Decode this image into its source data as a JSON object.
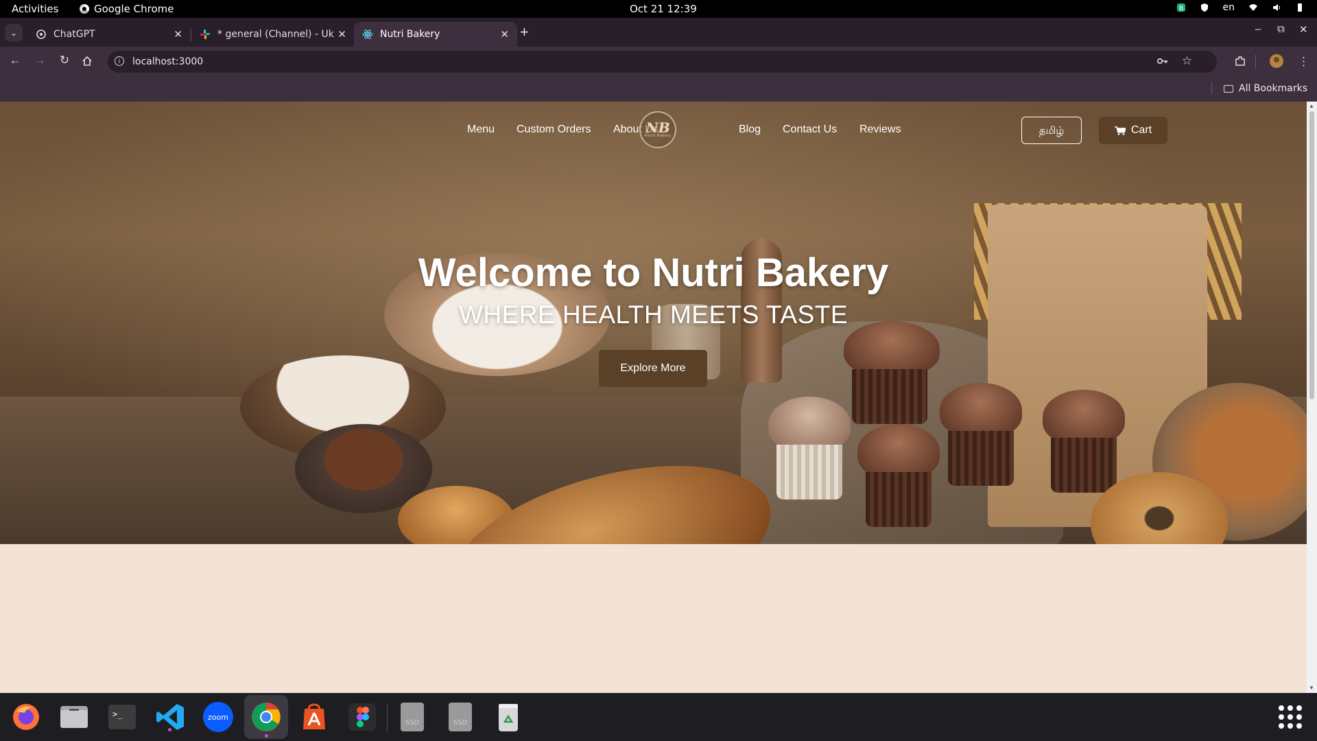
{
  "system_bar": {
    "activities": "Activities",
    "app_name": "Google Chrome",
    "clock": "Oct 21  12:39",
    "keyboard_lang": "en"
  },
  "browser": {
    "tabs": [
      {
        "title": "ChatGPT",
        "icon": "chatgpt-icon",
        "active": false
      },
      {
        "title": "* general (Channel) - Uki",
        "icon": "slack-icon",
        "active": false
      },
      {
        "title": "Nutri Bakery",
        "icon": "react-icon",
        "active": true
      }
    ],
    "url": "localhost:3000",
    "bookmarks_label": "All Bookmarks"
  },
  "site": {
    "nav": {
      "links_left": [
        "Menu",
        "Custom Orders",
        "About Us"
      ],
      "links_right": [
        "Blog",
        "Contact Us",
        "Reviews"
      ],
      "logo_monogram": "NB",
      "logo_subtitle": "Nutri Bakery",
      "language_button": "தமிழ்",
      "cart_button": "Cart"
    },
    "hero": {
      "title": "Welcome to Nutri Bakery",
      "subtitle": "WHERE HEALTH MEETS TASTE",
      "cta": "Explore More"
    }
  },
  "dock": {
    "apps": [
      "firefox-icon",
      "files-icon",
      "terminal-icon",
      "vscode-icon",
      "zoom-icon",
      "chrome-icon",
      "app-center-icon",
      "figma-icon",
      "ssd-drive-icon",
      "ssd-drive-icon",
      "trash-icon"
    ],
    "zoom_label": "zoom",
    "ssd_label": "SSD"
  },
  "colors": {
    "accent_brown": "#5b4028",
    "page_background": "#f3e2d6",
    "chrome_frame": "#3e2f3f"
  }
}
